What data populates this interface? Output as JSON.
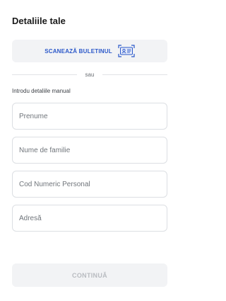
{
  "header": {
    "title": "Detaliile tale"
  },
  "scan": {
    "label": "SCANEAZĂ BULETINUL",
    "icon": "id-card-scan-icon",
    "accent_color": "#2a57c9"
  },
  "divider": {
    "text": "sau"
  },
  "manual": {
    "label": "Introdu detaliile manual",
    "fields": [
      {
        "placeholder": "Prenume",
        "value": ""
      },
      {
        "placeholder": "Nume de familie",
        "value": ""
      },
      {
        "placeholder": "Cod Numeric Personal",
        "value": ""
      },
      {
        "placeholder": "Adresă",
        "value": ""
      }
    ]
  },
  "actions": {
    "continue_label": "CONTINUĂ",
    "continue_state": "disabled"
  }
}
